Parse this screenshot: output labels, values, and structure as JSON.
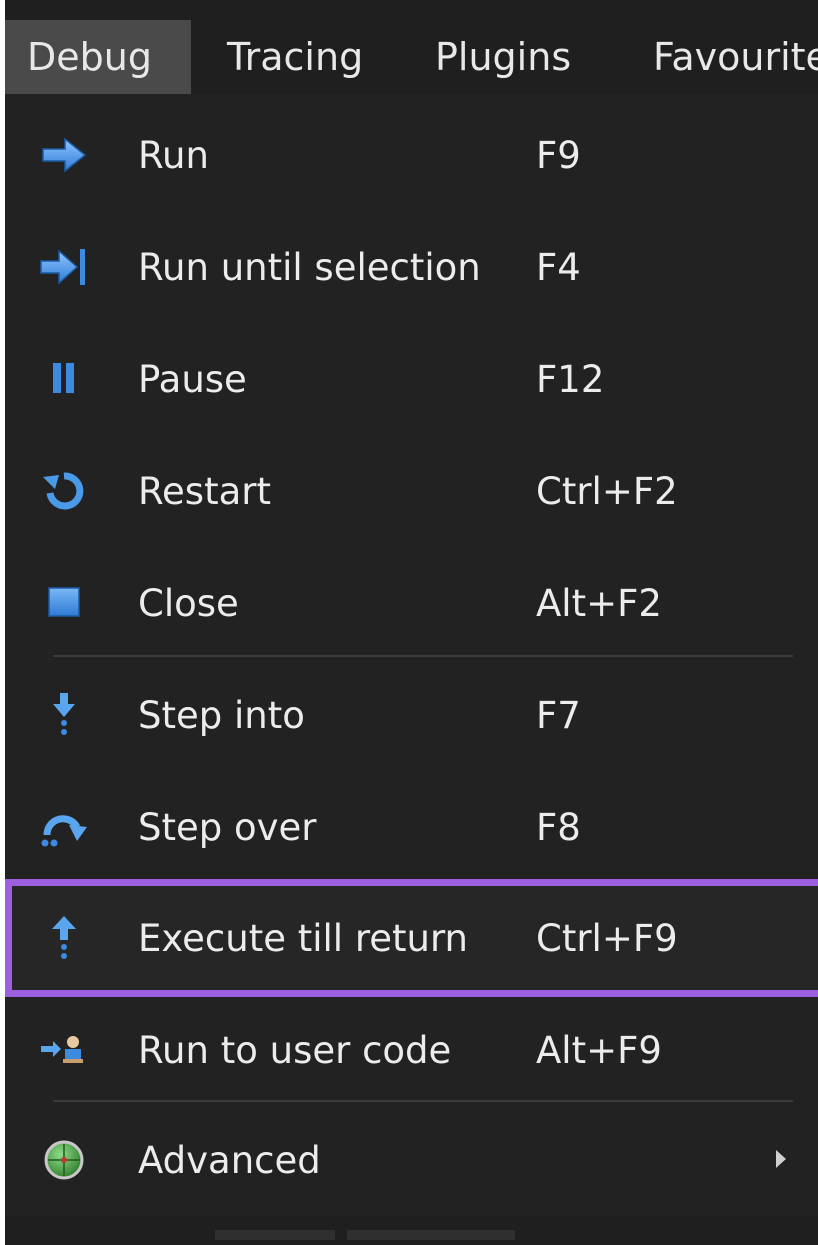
{
  "menubar": {
    "items": [
      {
        "label": "Debug",
        "active": true
      },
      {
        "label": "Tracing"
      },
      {
        "label": "Plugins"
      },
      {
        "label": "Favourite"
      }
    ]
  },
  "menu": {
    "items": [
      {
        "label": "Run",
        "shortcut": "F9",
        "icon": "run-arrow-icon"
      },
      {
        "label": "Run until selection",
        "shortcut": "F4",
        "icon": "run-until-selection-icon"
      },
      {
        "label": "Pause",
        "shortcut": "F12",
        "icon": "pause-icon"
      },
      {
        "label": "Restart",
        "shortcut": "Ctrl+F2",
        "icon": "restart-icon"
      },
      {
        "label": "Close",
        "shortcut": "Alt+F2",
        "icon": "close-square-icon"
      },
      {
        "label": "Step into",
        "shortcut": "F7",
        "icon": "step-into-icon"
      },
      {
        "label": "Step over",
        "shortcut": "F8",
        "icon": "step-over-icon"
      },
      {
        "label": "Execute till return",
        "shortcut": "Ctrl+F9",
        "icon": "execute-till-return-icon",
        "highlighted": true
      },
      {
        "label": "Run to user code",
        "shortcut": "Alt+F9",
        "icon": "run-to-user-code-icon"
      },
      {
        "label": "Advanced",
        "shortcut": "",
        "icon": "advanced-globe-icon",
        "submenu": true
      }
    ]
  },
  "colors": {
    "background": "#222222",
    "menubar_active": "#4a4a4a",
    "highlight_border": "#9b5fe0",
    "icon_blue": "#3d8be0",
    "text": "#ececec"
  }
}
